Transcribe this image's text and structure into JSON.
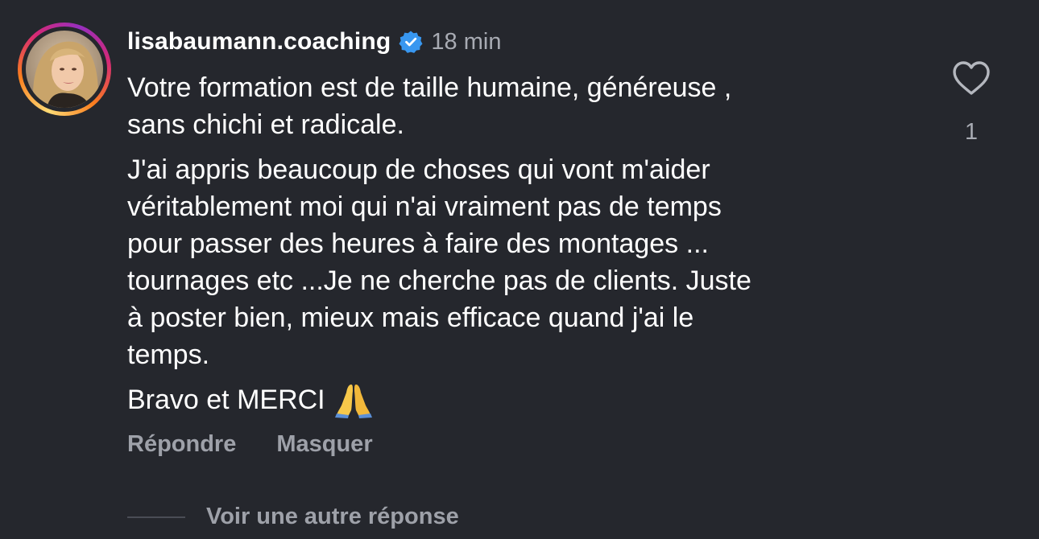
{
  "comment": {
    "username": "lisabaumann.coaching",
    "verified_icon": "verified-badge-icon",
    "timestamp": "18 min",
    "paragraphs": [
      [
        "Votre formation est de taille humaine, généreuse ,",
        "sans chichi et radicale."
      ],
      [
        "J'ai appris beaucoup de choses qui vont m'aider",
        "véritablement moi qui n'ai vraiment pas de temps",
        "pour passer des heures à faire des montages ...",
        "tournages etc ...Je ne cherche pas de clients. Juste",
        "à poster bien, mieux mais efficace quand j'ai le",
        "temps."
      ]
    ],
    "closing": "Bravo et MERCI",
    "closing_emoji": "folded-hands-emoji",
    "like_icon": "heart-outline-icon",
    "like_count": "1"
  },
  "actions": {
    "reply_label": "Répondre",
    "hide_label": "Masquer"
  },
  "replies": {
    "more_label": "Voir une autre réponse"
  },
  "colors": {
    "background": "#25272d",
    "text": "#ffffff",
    "secondary_text": "#a8abb3",
    "verified_blue": "#3897f0"
  }
}
